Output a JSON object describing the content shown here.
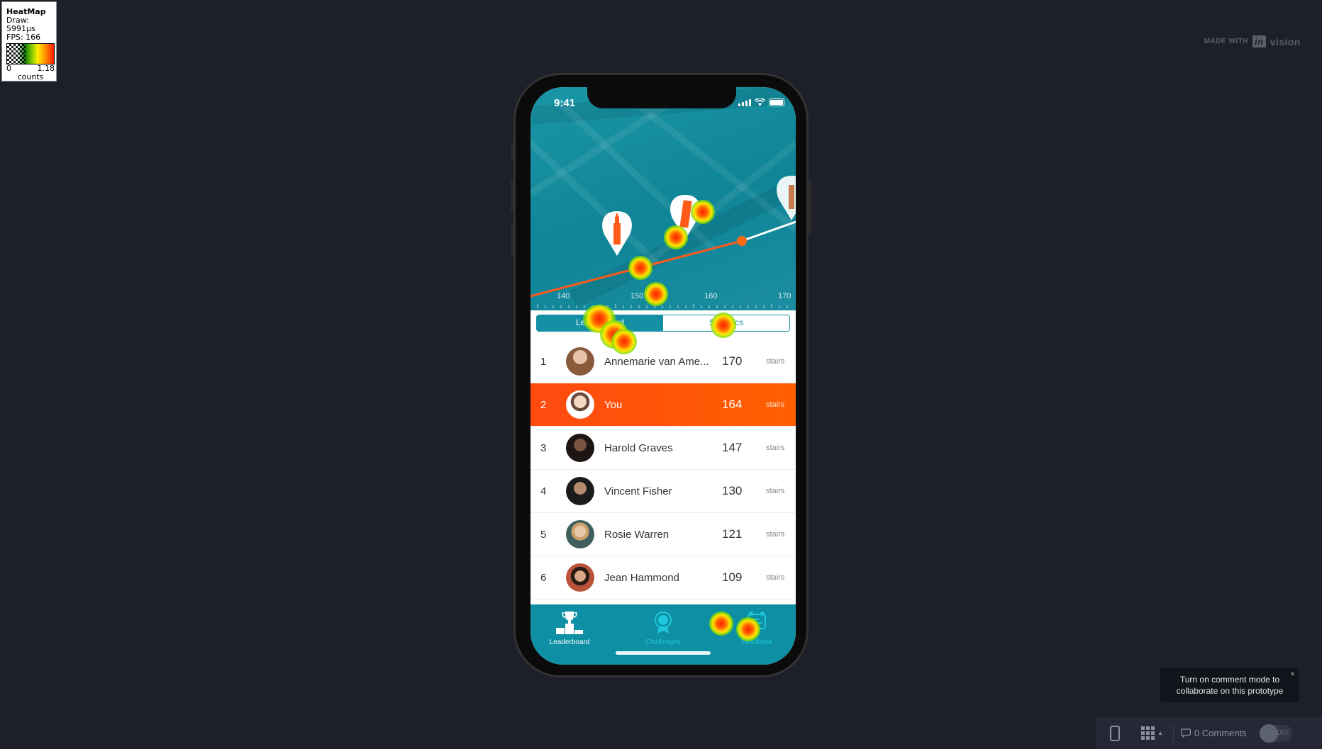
{
  "heatmap_legend": {
    "title": "HeatMap",
    "draw": "Draw: 5991µs",
    "fps": "FPS: 166",
    "scale_min": "0",
    "scale_max": "1.18",
    "unit": "counts"
  },
  "branding": {
    "made_with": "MADE WITH",
    "logo_in": "in",
    "logo_vision": "vision"
  },
  "phone": {
    "status": {
      "time": "9:41"
    },
    "hero": {
      "ticks": [
        "140",
        "150",
        "160",
        "170"
      ]
    },
    "segmented": {
      "left": "Leaderboard",
      "right": "Statistics"
    },
    "leaderboard": [
      {
        "rank": "1",
        "name": "Annemarie van Ame...",
        "score": "170",
        "unit": "stairs",
        "highlight": false,
        "avatar_color": "#c9a38a"
      },
      {
        "rank": "2",
        "name": "You",
        "score": "164",
        "unit": "stairs",
        "highlight": true,
        "avatar_color": "#f2e6dc"
      },
      {
        "rank": "3",
        "name": "Harold Graves",
        "score": "147",
        "unit": "stairs",
        "highlight": false,
        "avatar_color": "#3b2a22"
      },
      {
        "rank": "4",
        "name": "Vincent Fisher",
        "score": "130",
        "unit": "stairs",
        "highlight": false,
        "avatar_color": "#2c2c2c"
      },
      {
        "rank": "5",
        "name": "Rosie Warren",
        "score": "121",
        "unit": "stairs",
        "highlight": false,
        "avatar_color": "#4f6b6a"
      },
      {
        "rank": "6",
        "name": "Jean Hammond",
        "score": "109",
        "unit": "stairs",
        "highlight": false,
        "avatar_color": "#6b3f2f"
      }
    ],
    "tabbar": [
      {
        "label": "Leaderboard",
        "icon": "podium-trophy-icon",
        "active": true
      },
      {
        "label": "Challenges",
        "icon": "medal-icon",
        "active": false
      },
      {
        "label": "Feedback",
        "icon": "feedback-icon",
        "active": false
      }
    ]
  },
  "tooltip": {
    "line1": "Turn on comment mode to",
    "line2": "collaborate on this prototype",
    "close": "×"
  },
  "toolbar": {
    "comments": "0 Comments",
    "toggle": "OFF"
  },
  "colors": {
    "accent": "#1390a3",
    "highlight": "#ff5200",
    "background": "#1d1f29"
  }
}
